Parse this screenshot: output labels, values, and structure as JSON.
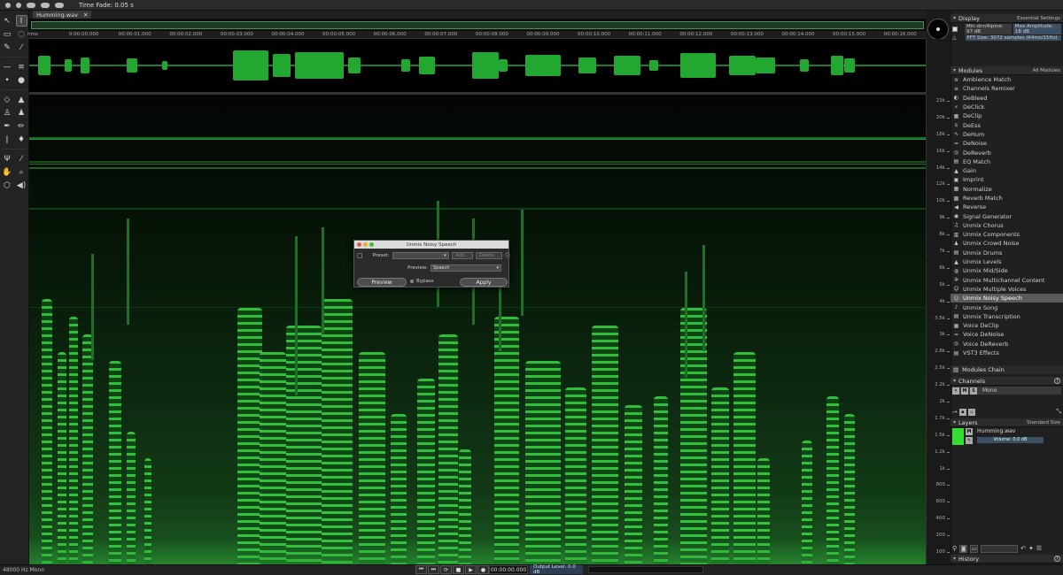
{
  "app": {
    "time_fade_label": "Time Fade: 0.05 s"
  },
  "file_tab": {
    "name": "Humming.wav",
    "close": "✕"
  },
  "ruler_ticks": [
    "hms",
    "0:00:00.000",
    "00:00:01.000",
    "00:00:02.000",
    "00:00:03.000",
    "00:00:04.000",
    "00:00:05.000",
    "00:00:06.000",
    "00:00:07.000",
    "00:00:08.000",
    "00:00:09.000",
    "00:00:10.000",
    "00:00:11.000",
    "00:00:12.000",
    "00:00:13.000",
    "00:00:14.000",
    "00:00:15.000",
    "00:00:16.000"
  ],
  "freq_ticks": [
    "23k",
    "20k",
    "18k",
    "16k",
    "14k",
    "12k",
    "10k",
    "9k",
    "8k",
    "7k",
    "6k",
    "5k",
    "4k",
    "3.5k",
    "3k",
    "2.8k",
    "2.5k",
    "2.2k",
    "2k",
    "1.7k",
    "1.5k",
    "1.2k",
    "1k",
    "800",
    "600",
    "400",
    "200",
    "100"
  ],
  "display": {
    "title": "Display",
    "preset": "Essential Settings",
    "row1_left": "Min dnr/Alpine: 97 dB",
    "row1_right": "Max Amplitude: 18 dB",
    "row2": "FFT Size: 3072 samples (64ms/15Hz)"
  },
  "modules": {
    "title": "Modules",
    "filter": "All Modules",
    "items": [
      {
        "label": "Ambience Match",
        "icon": "≋"
      },
      {
        "label": "Channels Remixer",
        "icon": "≡"
      },
      {
        "label": "DeBleed",
        "icon": "◐"
      },
      {
        "label": "DeClick",
        "icon": "⚡"
      },
      {
        "label": "DeClip",
        "icon": "▦"
      },
      {
        "label": "DeEss",
        "icon": "s"
      },
      {
        "label": "DeHum",
        "icon": "∿"
      },
      {
        "label": "DeNoise",
        "icon": "≈"
      },
      {
        "label": "DeReverb",
        "icon": "◎"
      },
      {
        "label": "EQ Match",
        "icon": "▤"
      },
      {
        "label": "Gain",
        "icon": "▲"
      },
      {
        "label": "Imprint",
        "icon": "▣"
      },
      {
        "label": "Normalize",
        "icon": "▦"
      },
      {
        "label": "Reverb Match",
        "icon": "▩"
      },
      {
        "label": "Reverse",
        "icon": "◀"
      },
      {
        "label": "Signal Generator",
        "icon": "◉"
      },
      {
        "label": "Unmix Chorus",
        "icon": "♫"
      },
      {
        "label": "Unmix Components",
        "icon": "▥"
      },
      {
        "label": "Unmix Crowd Noise",
        "icon": "♟"
      },
      {
        "label": "Unmix Drums",
        "icon": "▤"
      },
      {
        "label": "Unmix Levels",
        "icon": "▲"
      },
      {
        "label": "Unmix Mid/Side",
        "icon": "◍"
      },
      {
        "label": "Unmix Multichannel Content",
        "icon": "✲"
      },
      {
        "label": "Unmix Multiple Voices",
        "icon": "☺"
      },
      {
        "label": "Unmix Noisy Speech",
        "icon": "☺"
      },
      {
        "label": "Unmix Song",
        "icon": "♪"
      },
      {
        "label": "Unmix Transcription",
        "icon": "▤"
      },
      {
        "label": "Voice DeClip",
        "icon": "▦"
      },
      {
        "label": "Voice DeNoise",
        "icon": "≈"
      },
      {
        "label": "Voice DeReverb",
        "icon": "◎"
      },
      {
        "label": "VST3 Effects",
        "icon": "▤"
      }
    ],
    "selected": "Unmix Noisy Speech",
    "chain": "Modules Chain"
  },
  "channels": {
    "title": "Channels",
    "row": {
      "m": "M",
      "s": "S",
      "name": "Mono"
    }
  },
  "layers": {
    "title": "Layers",
    "preset": "Standard Size",
    "name": "Humming.wav",
    "volume": "Volume: 0.0 dB"
  },
  "history": {
    "title": "History"
  },
  "status": {
    "format": "48000 Hz Mono",
    "time": "00:00:00.000",
    "output_level": "Output Level: 0.0 dB"
  },
  "transport": [
    "⏮",
    "⏭",
    "⟳",
    "■",
    "▶",
    "●"
  ],
  "dialog": {
    "title": "Unmix Noisy Speech",
    "preset_label": "Preset:",
    "add": "Add...",
    "delete": "Delete...",
    "preview_label": "Preview:",
    "preview_value": "Speech",
    "preview_button": "Preview",
    "bypass": "Bypass",
    "apply": "Apply"
  }
}
